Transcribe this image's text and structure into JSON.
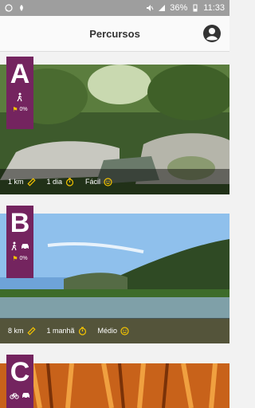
{
  "status": {
    "battery": "36%",
    "time": "11:33"
  },
  "header": {
    "title": "Percursos"
  },
  "routes": [
    {
      "letter": "A",
      "progress": "0%",
      "distance": "1 km",
      "duration": "1 dia",
      "difficulty": "Fácil",
      "modes": [
        "walking-icon"
      ]
    },
    {
      "letter": "B",
      "progress": "0%",
      "distance": "8 km",
      "duration": "1 manhã",
      "difficulty": "Médio",
      "modes": [
        "walking-icon",
        "car-icon"
      ]
    },
    {
      "letter": "C",
      "modes": [
        "bicycle-icon",
        "car-icon"
      ]
    }
  ],
  "colors": {
    "badge": "#74245f",
    "accent": "#f5c400"
  }
}
